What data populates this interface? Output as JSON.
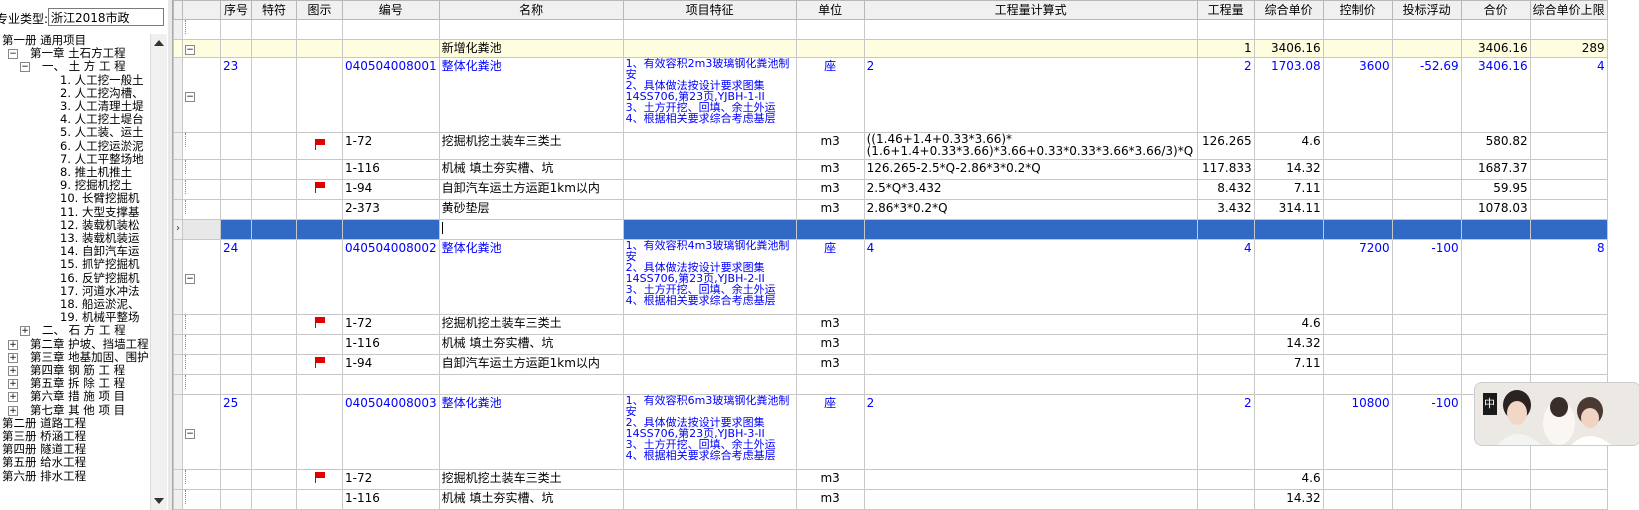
{
  "left_panel": {
    "profession_label": "专业类型:",
    "profession_value": "浙江2018市政",
    "tree": [
      {
        "label": "第一册 通用项目",
        "indent": 0,
        "exp": ""
      },
      {
        "label": "第一章 土石方工程",
        "indent": 1,
        "exp": "−"
      },
      {
        "label": "一、 土 方 工 程",
        "indent": 2,
        "exp": "−"
      },
      {
        "label": "1. 人工挖一般土",
        "indent": 3,
        "exp": ""
      },
      {
        "label": "2. 人工挖沟槽、",
        "indent": 3,
        "exp": ""
      },
      {
        "label": "3. 人工清理土堤",
        "indent": 3,
        "exp": ""
      },
      {
        "label": "4. 人工挖土堤台",
        "indent": 3,
        "exp": ""
      },
      {
        "label": "5. 人工装、运土",
        "indent": 3,
        "exp": ""
      },
      {
        "label": "6. 人工挖运淤泥",
        "indent": 3,
        "exp": ""
      },
      {
        "label": "7. 人工平整场地",
        "indent": 3,
        "exp": ""
      },
      {
        "label": "8. 推土机推土",
        "indent": 3,
        "exp": ""
      },
      {
        "label": "9. 挖掘机挖土",
        "indent": 3,
        "exp": ""
      },
      {
        "label": "10. 长臂挖掘机",
        "indent": 3,
        "exp": ""
      },
      {
        "label": "11. 大型支撑基",
        "indent": 3,
        "exp": ""
      },
      {
        "label": "12. 装载机装松",
        "indent": 3,
        "exp": ""
      },
      {
        "label": "13. 装载机装运",
        "indent": 3,
        "exp": ""
      },
      {
        "label": "14. 自卸汽车运",
        "indent": 3,
        "exp": ""
      },
      {
        "label": "15. 抓铲挖掘机",
        "indent": 3,
        "exp": ""
      },
      {
        "label": "16. 反铲挖掘机",
        "indent": 3,
        "exp": ""
      },
      {
        "label": "17. 河道水冲法",
        "indent": 3,
        "exp": ""
      },
      {
        "label": "18. 船运淤泥、",
        "indent": 3,
        "exp": ""
      },
      {
        "label": "19. 机械平整场",
        "indent": 3,
        "exp": ""
      },
      {
        "label": "二、 石 方 工 程",
        "indent": 2,
        "exp": "+"
      },
      {
        "label": "第二章 护坡、挡墙工程",
        "indent": 1,
        "exp": "+"
      },
      {
        "label": "第三章 地基加固、围护",
        "indent": 1,
        "exp": "+"
      },
      {
        "label": "第四章 钢 筋 工 程",
        "indent": 1,
        "exp": "+"
      },
      {
        "label": "第五章 拆 除 工 程",
        "indent": 1,
        "exp": "+"
      },
      {
        "label": "第六章 措 施 项 目",
        "indent": 1,
        "exp": "+"
      },
      {
        "label": "第七章 其 他 项 目",
        "indent": 1,
        "exp": "+"
      },
      {
        "label": "第二册 道路工程",
        "indent": 0,
        "exp": ""
      },
      {
        "label": "第三册 桥涵工程",
        "indent": 0,
        "exp": ""
      },
      {
        "label": "第四册 隧道工程",
        "indent": 0,
        "exp": ""
      },
      {
        "label": "第五册 给水工程",
        "indent": 0,
        "exp": ""
      },
      {
        "label": "第六册 排水工程",
        "indent": 0,
        "exp": ""
      }
    ]
  },
  "grid": {
    "headers": [
      "序号",
      "特符",
      "图示",
      "编号",
      "名称",
      "项目特征",
      "单位",
      "工程量计算式",
      "工程量",
      "综合单价",
      "控制价",
      "投标浮动",
      "合价",
      "综合单价上限"
    ],
    "summary": {
      "name": "新增化粪池",
      "qty": "1",
      "unit_price": "3406.16",
      "total": "3406.16",
      "upper": "289"
    },
    "items": [
      {
        "seq": "23",
        "code": "040504008001",
        "name": "整体化粪池",
        "features": [
          "1、有效容积2m3玻璃钢化粪池制安",
          "2、具体做法按设计要求图集14SS706,第23页,YJBH-1-II",
          "3、土方开挖、回填、余土外运",
          "4、根据相关要求综合考虑基层"
        ],
        "unit": "座",
        "formula": "2",
        "qty": "2",
        "unit_price": "1703.08",
        "control": "3600",
        "float": "-52.69",
        "total": "3406.16",
        "upper": "4",
        "subs": [
          {
            "flag": true,
            "code": "1-72",
            "name": "挖掘机挖土装车三类土",
            "unit": "m3",
            "formula": "((1.46+1.4+0.33*3.66)*(1.6+1.4+0.33*3.66)*3.66+0.33*0.33*3.66*3.66/3)*Q",
            "qty": "126.265",
            "price": "4.6",
            "total": "580.82"
          },
          {
            "flag": false,
            "code": "1-116",
            "name": "机械 填土夯实槽、坑",
            "unit": "m3",
            "formula": "126.265-2.5*Q-2.86*3*0.2*Q",
            "qty": "117.833",
            "price": "14.32",
            "total": "1687.37"
          },
          {
            "flag": true,
            "code": "1-94",
            "name": "自卸汽车运土方运距1km以内",
            "unit": "m3",
            "formula": "2.5*Q*3.432",
            "qty": "8.432",
            "price": "7.11",
            "total": "59.95"
          },
          {
            "flag": false,
            "code": "2-373",
            "name": "黄砂垫层",
            "unit": "m3",
            "formula": "2.86*3*0.2*Q",
            "qty": "3.432",
            "price": "314.11",
            "total": "1078.03"
          }
        ]
      },
      {
        "seq": "24",
        "code": "040504008002",
        "name": "整体化粪池",
        "features": [
          "1、有效容积4m3玻璃钢化粪池制安",
          "2、具体做法按设计要求图集14SS706,第23页,YJBH-2-II",
          "3、土方开挖、回填、余土外运",
          "4、根据相关要求综合考虑基层"
        ],
        "unit": "座",
        "formula": "4",
        "qty": "4",
        "unit_price": "",
        "control": "7200",
        "float": "-100",
        "total": "",
        "upper": "8",
        "subs": [
          {
            "flag": true,
            "code": "1-72",
            "name": "挖掘机挖土装车三类土",
            "unit": "m3",
            "formula": "",
            "qty": "",
            "price": "4.6",
            "total": ""
          },
          {
            "flag": false,
            "code": "1-116",
            "name": "机械 填土夯实槽、坑",
            "unit": "m3",
            "formula": "",
            "qty": "",
            "price": "14.32",
            "total": ""
          },
          {
            "flag": true,
            "code": "1-94",
            "name": "自卸汽车运土方运距1km以内",
            "unit": "m3",
            "formula": "",
            "qty": "",
            "price": "7.11",
            "total": ""
          }
        ]
      },
      {
        "seq": "25",
        "code": "040504008003",
        "name": "整体化粪池",
        "features": [
          "1、有效容积6m3玻璃钢化粪池制安",
          "2、具体做法按设计要求图集14SS706,第23页,YJBH-3-II",
          "3、土方开挖、回填、余土外运",
          "4、根据相关要求综合考虑基层"
        ],
        "unit": "座",
        "formula": "2",
        "qty": "2",
        "unit_price": "",
        "control": "10800",
        "float": "-100",
        "total": "",
        "upper": "",
        "subs": [
          {
            "flag": true,
            "code": "1-72",
            "name": "挖掘机挖土装车三类土",
            "unit": "m3",
            "formula": "",
            "qty": "",
            "price": "4.6",
            "total": ""
          },
          {
            "flag": false,
            "code": "1-116",
            "name": "机械 填土夯实槽、坑",
            "unit": "m3",
            "formula": "",
            "qty": "",
            "price": "14.32",
            "total": ""
          }
        ]
      }
    ]
  },
  "overlay": {
    "avatar_label": "中"
  }
}
